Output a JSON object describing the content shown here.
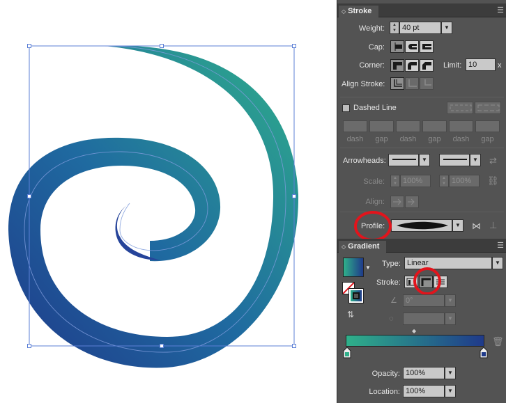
{
  "stroke_panel": {
    "tab_label": "Stroke",
    "weight": {
      "label": "Weight:",
      "value": "40 pt"
    },
    "cap": {
      "label": "Cap:",
      "buttons": [
        "butt-cap",
        "round-cap",
        "projecting-cap"
      ]
    },
    "corner": {
      "label": "Corner:",
      "buttons": [
        "miter-join",
        "round-join",
        "bevel-join"
      ],
      "limit_label": "Limit:",
      "limit_value": "10",
      "limit_unit": "x"
    },
    "align_stroke": {
      "label": "Align Stroke:",
      "buttons": [
        "align-center",
        "align-inside",
        "align-outside"
      ]
    },
    "dashed_line": {
      "label": "Dashed Line",
      "checked": false
    },
    "dash_gap_labels": [
      "dash",
      "gap",
      "dash",
      "gap",
      "dash",
      "gap"
    ],
    "arrowheads": {
      "label": "Arrowheads:"
    },
    "scale": {
      "label": "Scale:",
      "start": "100%",
      "end": "100%"
    },
    "align": {
      "label": "Align:"
    },
    "profile": {
      "label": "Profile:"
    }
  },
  "gradient_panel": {
    "tab_label": "Gradient",
    "type": {
      "label": "Type:",
      "value": "Linear"
    },
    "stroke": {
      "label": "Stroke:"
    },
    "angle_value": "0°",
    "opacity": {
      "label": "Opacity:",
      "value": "100%"
    },
    "location": {
      "label": "Location:",
      "value": "100%"
    },
    "colors": {
      "start": "#2fb08a",
      "end": "#1f3a8a"
    }
  },
  "colors": {
    "panel_bg": "#535353",
    "tab_bg": "#3c3c3c",
    "highlight": "#e2141c",
    "selection": "#5b7fd6"
  }
}
